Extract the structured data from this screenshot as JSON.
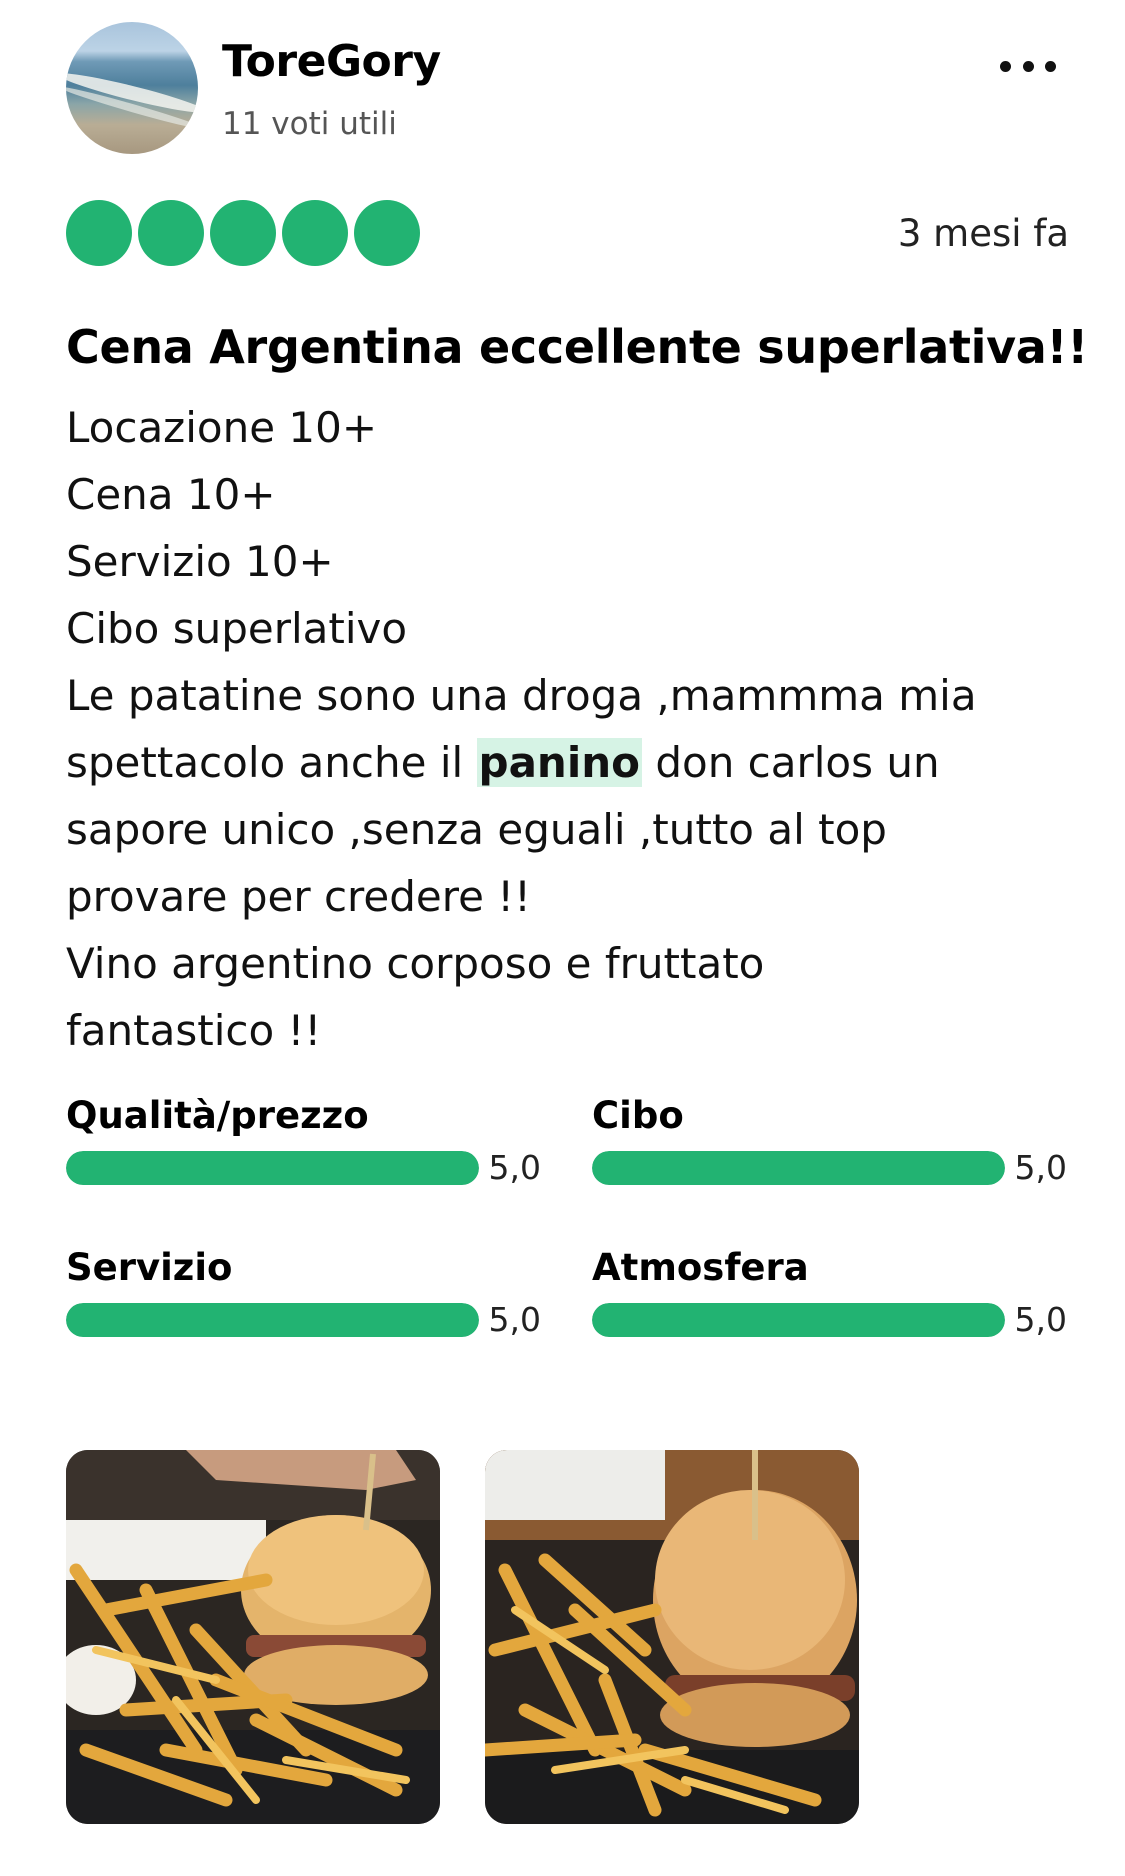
{
  "review": {
    "author": "ToreGory",
    "helpful_votes": "11 voti utili",
    "rating": 5,
    "rating_max": 5,
    "date": "3 mesi fa",
    "title": "Cena Argentina eccellente superlativa!!",
    "body": {
      "line1": "Locazione 10+",
      "line2": "Cena 10+",
      "line3": "Servizio 10+",
      "line4": "Cibo superlativo",
      "line5": "Le patatine sono una droga ,mammma mia",
      "line6_before": "spettacolo anche il ",
      "line6_highlight": "panino",
      "line6_after": " don carlos un",
      "line7": "sapore unico ,senza eguali ,tutto al top",
      "line8": "provare per credere !!",
      "line9": "Vino argentino corposo e fruttato",
      "line10": "fantastico !!"
    },
    "subratings": [
      {
        "label": "Qualità/prezzo",
        "score": "5,0",
        "fraction": 1.0
      },
      {
        "label": "Cibo",
        "score": "5,0",
        "fraction": 1.0
      },
      {
        "label": "Servizio",
        "score": "5,0",
        "fraction": 1.0
      },
      {
        "label": "Atmosfera",
        "score": "5,0",
        "fraction": 1.0
      }
    ]
  },
  "colors": {
    "accent_green": "#22b372",
    "highlight_bg": "#d6f3e5"
  },
  "icons": {
    "more": "more-options-icon"
  }
}
